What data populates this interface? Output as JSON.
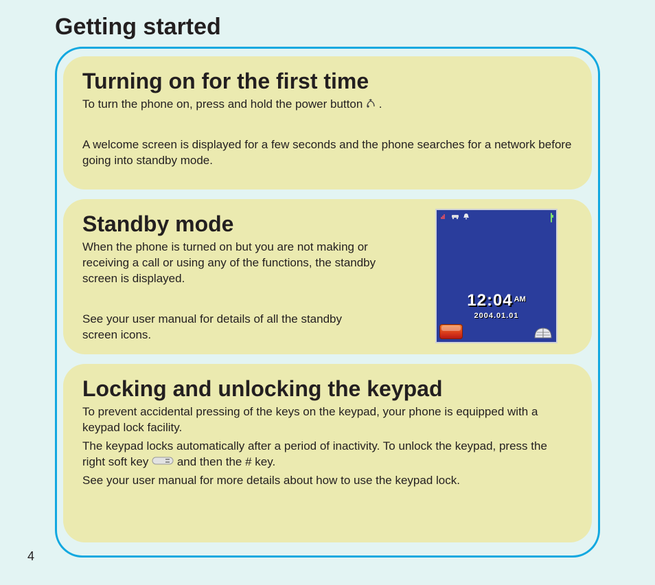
{
  "page": {
    "title": "Getting started",
    "number": "4"
  },
  "sections": {
    "turn_on": {
      "title": "Turning on for the first time",
      "p1a": "To turn the phone on, press and hold the power button ",
      "p1b": ".",
      "p2": "A welcome screen is displayed for a few seconds and the phone searches for a network before going into standby mode."
    },
    "standby": {
      "title": "Standby mode",
      "p1": "When the phone is turned on but you are not making or receiving a call or using any of the functions, the standby screen is displayed.",
      "p2": "See your user manual for details of all the standby screen icons."
    },
    "lock": {
      "title": "Locking and unlocking the keypad",
      "p1": "To prevent accidental pressing of the keys on the keypad, your phone is equipped with a keypad lock facility.",
      "p2a": "The keypad locks automatically after a period of inactivity. To unlock the keypad, press the right soft key ",
      "p2b": " and then the # key.",
      "p3": "See your user manual for more details about how to use the keypad lock."
    }
  },
  "phone": {
    "time": "12:04",
    "ampm": "AM",
    "date": "2004.01.01"
  },
  "icons": {
    "power": "power-icon",
    "softkey": "softkey-icon"
  }
}
